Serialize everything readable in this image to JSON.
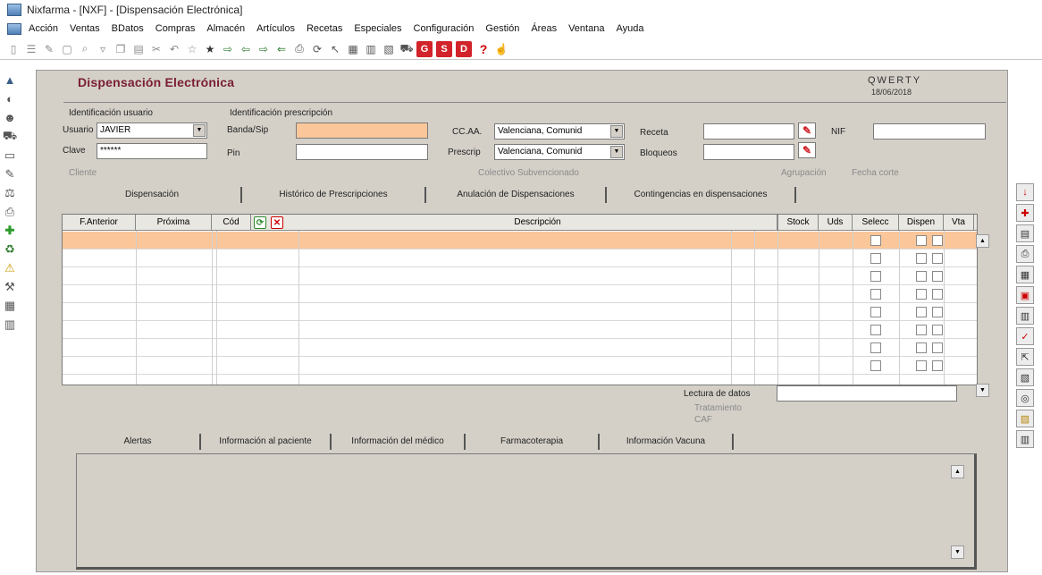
{
  "window": {
    "title": "Nixfarma - [NXF] - [Dispensación Electrónica]"
  },
  "menu": [
    "Acción",
    "Ventas",
    "BDatos",
    "Compras",
    "Almacén",
    "Artículos",
    "Recetas",
    "Especiales",
    "Configuración",
    "Gestión",
    "Áreas",
    "Ventana",
    "Ayuda"
  ],
  "form": {
    "title": "Dispensación Electrónica",
    "user_code": "QWERTY",
    "date": "18/06/2018"
  },
  "user_section": {
    "title": "Identificación usuario",
    "usuario_label": "Usuario",
    "usuario_value": "JAVIER",
    "clave_label": "Clave",
    "clave_value": "******"
  },
  "prescription_section": {
    "title": "Identificación prescripción",
    "banda_label": "Banda/Sip",
    "banda_value": "",
    "pin_label": "Pin",
    "pin_value": ""
  },
  "region": {
    "ccaa_label": "CC.AA.",
    "ccaa_value": "Valenciana, Comunid",
    "prescrip_label": "Prescrip",
    "prescrip_value": "Valenciana, Comunid"
  },
  "receta": {
    "receta_label": "Receta",
    "bloqueos_label": "Bloqueos",
    "nif_label": "NIF"
  },
  "info_labels": {
    "cliente": "Cliente",
    "colectivo": "Colectivo Subvencionado",
    "agrupacion": "Agrupación",
    "fecha_corte": "Fecha corte"
  },
  "main_tabs": [
    "Dispensación",
    "Histórico de Prescripciones",
    "Anulación de Dispensaciones",
    "Contingencias en dispensaciones"
  ],
  "grid": {
    "columns": [
      "F.Anterior",
      "Próxima",
      "Cód",
      "Descripción",
      "Stock",
      "Uds",
      "Selecc",
      "Dispen",
      "Vta"
    ]
  },
  "bottom": {
    "lectura_label": "Lectura de datos",
    "tratamiento_label": "Tratamiento",
    "caf_label": "CAF"
  },
  "bottom_tabs": [
    "Alertas",
    "Información al paciente",
    "Información del médico",
    "Farmacoterapia",
    "Información Vacuna"
  ],
  "colors": {
    "title": "#7a1d34",
    "selected_row": "#fbc79a",
    "panel": "#d4d0c8"
  }
}
